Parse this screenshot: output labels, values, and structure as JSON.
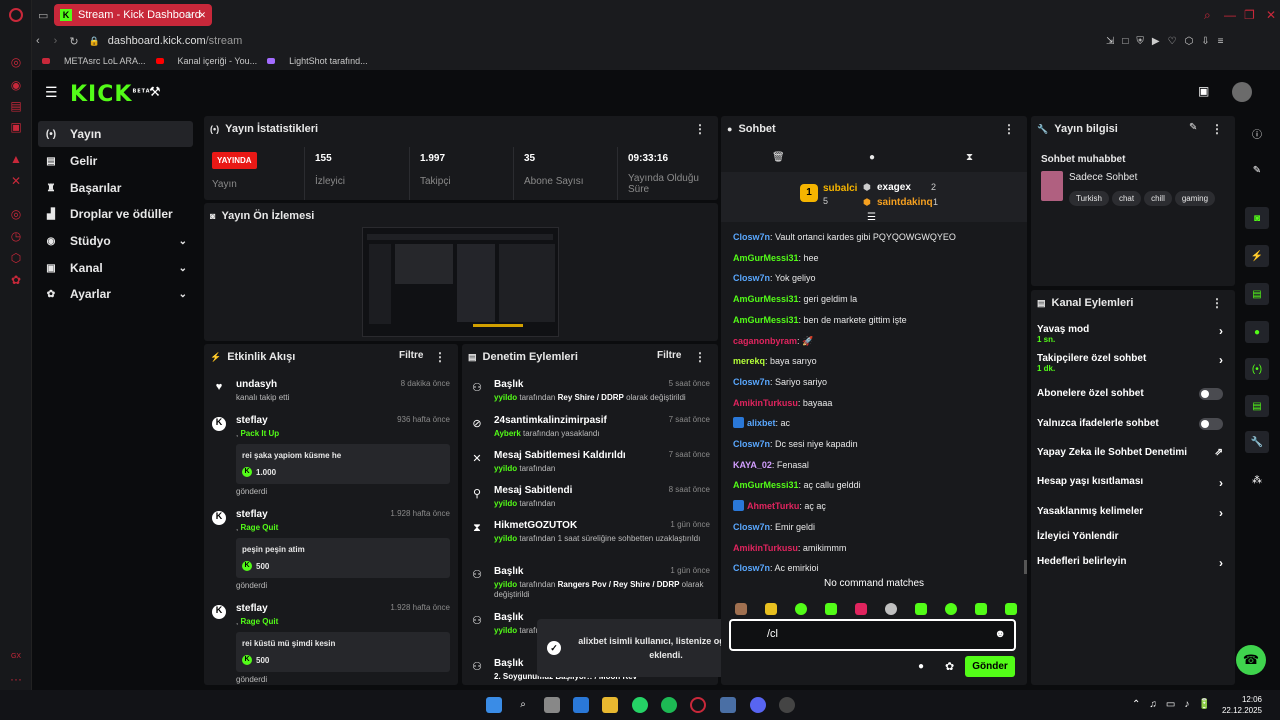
{
  "browser": {
    "tab_title": "Stream - Kick Dashboard",
    "url_domain": "dashboard.kick.com",
    "url_path": "/stream",
    "bookmarks": [
      "METAsrc LoL ARA...",
      "Kanal içeriği - You...",
      "LightShot tarafınd..."
    ]
  },
  "site": {
    "logo": "KICK",
    "logo_badge": "BETA"
  },
  "nav": [
    {
      "label": "Yayın",
      "icon": "radio-icon",
      "glyph": "(•)"
    },
    {
      "label": "Gelir",
      "icon": "chart-icon",
      "glyph": "▤"
    },
    {
      "label": "Başarılar",
      "icon": "trophy-icon",
      "glyph": "♜"
    },
    {
      "label": "Droplar ve ödüller",
      "icon": "gift-icon",
      "glyph": "▟"
    },
    {
      "label": "Stüdyo",
      "icon": "studio-icon",
      "glyph": "◉"
    },
    {
      "label": "Kanal",
      "icon": "channel-icon",
      "glyph": "▣"
    },
    {
      "label": "Ayarlar",
      "icon": "gear-icon",
      "glyph": "✿"
    }
  ],
  "stats": {
    "title": "Yayın İstatistikleri",
    "live_badge": "YAYINDA",
    "live_label": "Yayın",
    "items": [
      {
        "value": "155",
        "label": "İzleyici"
      },
      {
        "value": "1.997",
        "label": "Takipçi"
      },
      {
        "value": "35",
        "label": "Abone Sayısı"
      },
      {
        "value": "09:33:16",
        "label": "Yayında Olduğu Süre"
      }
    ]
  },
  "preview": {
    "title": "Yayın Ön İzlemesi"
  },
  "activity": {
    "title": "Etkinlik Akışı",
    "filter": "Filtre",
    "items": [
      {
        "name": "undasyh",
        "time": "8 dakika önce",
        "sub": "kanalı takip etti"
      },
      {
        "name": "steflay",
        "time": "936 hafta önce",
        "reward": "Pack It Up",
        "message": "rei şaka yapiom küsme he",
        "amount": "1.000",
        "footer": "gönderdi"
      },
      {
        "name": "steflay",
        "time": "1.928 hafta önce",
        "reward": "Rage Quit",
        "message": "peşin peşin atim",
        "amount": "500",
        "footer": "gönderdi"
      },
      {
        "name": "steflay",
        "time": "1.928 hafta önce",
        "reward": "Rage Quit",
        "message": "rei küstü mü şimdi kesin",
        "amount": "500",
        "footer": "gönderdi"
      }
    ]
  },
  "moderation": {
    "title": "Denetim Eylemleri",
    "filter": "Filtre",
    "items": [
      {
        "title": "Başlık",
        "time": "5 saat önce",
        "actor": "yyildo",
        "text": " tarafından ",
        "bold": "Rey Shire / DDRP",
        "tail": " olarak değiştirildi"
      },
      {
        "title": "24santimkalinzimirpasif",
        "time": "7 saat önce",
        "actor": "Ayberk",
        "text": " tarafından yasaklandı",
        "bold": "",
        "tail": ""
      },
      {
        "title": "Mesaj Sabitlemesi Kaldırıldı",
        "time": "7 saat önce",
        "actor": "yyildo",
        "text": " tarafından",
        "bold": "",
        "tail": ""
      },
      {
        "title": "Mesaj Sabitlendi",
        "time": "8 saat önce",
        "actor": "yyildo",
        "text": " tarafından",
        "bold": "",
        "tail": ""
      },
      {
        "title": "HikmetGOZUTOK",
        "time": "1 gün önce",
        "actor": "yyildo",
        "text": " tarafından 1 saat süreliğine sohbetten uzaklaştırıldı",
        "bold": "",
        "tail": ""
      },
      {
        "title": "Başlık",
        "time": "1 gün önce",
        "actor": "yyildo",
        "text": " tarafından ",
        "bold": "Rangers Pov / Rey Shire / DDRP",
        "tail": " olarak değiştirildi"
      },
      {
        "title": "Başlık",
        "time": "",
        "actor": "yyildo",
        "text": " tarafından",
        "bold": "",
        "tail": " değiştirildi"
      },
      {
        "title": "Başlık",
        "time": "",
        "actor": "",
        "text": "",
        "bold": "2. Soygunumuz Başlıyor!! / Moon Rev",
        "tail": ""
      }
    ]
  },
  "toast": {
    "text": "alixbet isimli kullanıcı, listenize og olarak eklendi."
  },
  "chat": {
    "title": "Sohbet",
    "leaders": [
      {
        "name": "subalci",
        "count": "5"
      },
      {
        "name": "exagex",
        "count": "2"
      },
      {
        "name": "saintdakinq",
        "count": "1"
      }
    ],
    "leader_rank": "1",
    "messages": [
      {
        "user": "Closw7n",
        "color": "#5aa8ff",
        "text": "Vault ortanci kardes gibi PQYQOWGWQYEO"
      },
      {
        "user": "AmGurMessi31",
        "color": "#53fc18",
        "text": "hee"
      },
      {
        "user": "Closw7n",
        "color": "#5aa8ff",
        "text": "Yok geliyo"
      },
      {
        "user": "AmGurMessi31",
        "color": "#53fc18",
        "text": "geri geldim la"
      },
      {
        "user": "AmGurMessi31",
        "color": "#53fc18",
        "text": "ben de markete gittim işte"
      },
      {
        "user": "caganonbyram",
        "color": "#e0245e",
        "text": "🚀"
      },
      {
        "user": "merekq",
        "color": "#b4ff39",
        "text": "baya sarıyo"
      },
      {
        "user": "Closw7n",
        "color": "#5aa8ff",
        "text": "Sariyo sariyo"
      },
      {
        "user": "AmikinTurkusu",
        "color": "#e0245e",
        "text": "bayaaa"
      },
      {
        "user": "alixbet",
        "color": "#5aa8ff",
        "text": "ac"
      },
      {
        "user": "Closw7n",
        "color": "#5aa8ff",
        "text": "Dc sesi niye kapadin"
      },
      {
        "user": "KAYA_02",
        "color": "#d29eff",
        "text": "Fenasal"
      },
      {
        "user": "AmGurMessi31",
        "color": "#53fc18",
        "text": "aç callu gelddi"
      },
      {
        "user": "AhmetTurku",
        "color": "#e0245e",
        "text": "aç aç"
      },
      {
        "user": "Closw7n",
        "color": "#5aa8ff",
        "text": "Emir geldi"
      },
      {
        "user": "AmikinTurkusu",
        "color": "#e0245e",
        "text": "amikimmm"
      },
      {
        "user": "Closw7n",
        "color": "#5aa8ff",
        "text": "Ac emirkioi"
      }
    ],
    "no_command": "No command matches",
    "input_value": "/cl",
    "send_label": "Gönder"
  },
  "stream_info": {
    "title": "Yayın bilgisi",
    "heading": "Sohbet muhabbet",
    "category": "Sadece Sohbet",
    "tags": [
      "Turkish",
      "chat",
      "chill",
      "gaming"
    ]
  },
  "channel_actions": {
    "title": "Kanal Eylemleri",
    "items": [
      {
        "label": "Yavaş mod",
        "sub": "1 sn.",
        "control": "chevron"
      },
      {
        "label": "Takipçilere özel sohbet",
        "sub": "1 dk.",
        "control": "chevron"
      },
      {
        "label": "Abonelere özel sohbet",
        "sub": "",
        "control": "toggle"
      },
      {
        "label": "Yalnızca ifadelerle sohbet",
        "sub": "",
        "control": "toggle"
      },
      {
        "label": "Yapay Zeka ile Sohbet Denetimi",
        "sub": "",
        "control": "external"
      },
      {
        "label": "Hesap yaşı kısıtlaması",
        "sub": "",
        "control": "chevron"
      },
      {
        "label": "Yasaklanmış kelimeler",
        "sub": "",
        "control": "chevron"
      },
      {
        "label": "İzleyici Yönlendir",
        "sub": "",
        "control": "none"
      },
      {
        "label": "Hedefleri belirleyin",
        "sub": "",
        "control": "chevron"
      }
    ]
  },
  "taskbar": {
    "time": "12:06",
    "date": "22.12.2025"
  },
  "colors": {
    "accent": "#53fc18",
    "live": "#e91916",
    "panel": "#18191c",
    "background": "#0b0c0e"
  }
}
